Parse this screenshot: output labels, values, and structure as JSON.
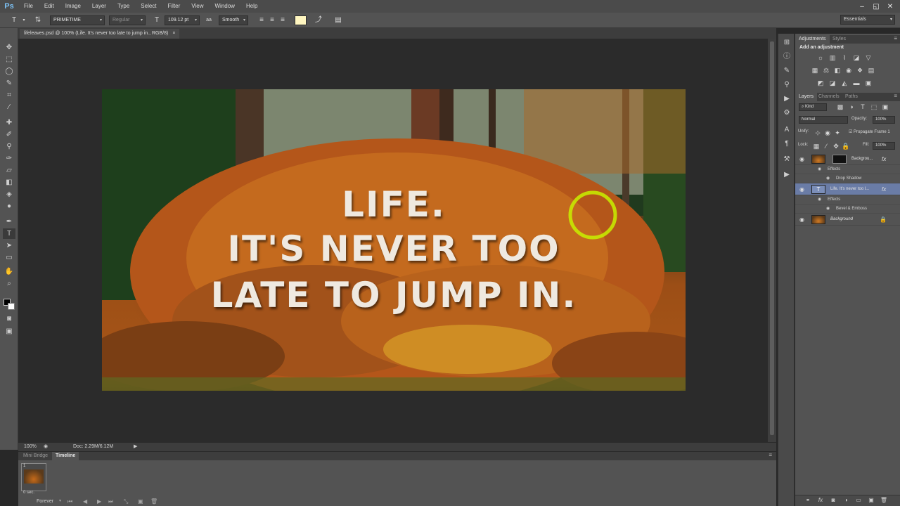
{
  "app": {
    "logo": "Ps",
    "menu": [
      "File",
      "Edit",
      "Image",
      "Layer",
      "Type",
      "Select",
      "Filter",
      "View",
      "Window",
      "Help"
    ],
    "window_controls": [
      "–",
      "◱",
      "✕"
    ]
  },
  "options_bar": {
    "font_family": "PRIMETIME",
    "font_style": "Regular",
    "font_size": "109.12 pt",
    "antialias": "Smooth",
    "text_color": "#fff6c0",
    "workspace": "Essentials"
  },
  "document": {
    "tab_title": "lifeleaves.psd @ 100% (Life. It's never too late to jump in., RGB/8)",
    "close_glyph": "×",
    "canvas_text": [
      "LIFE.",
      "IT'S NEVER TOO",
      "LATE TO JUMP IN."
    ]
  },
  "status_bar": {
    "zoom": "100%",
    "doc_size": "Doc: 2.29M/6.12M"
  },
  "timeline": {
    "tabs": [
      "Mini Bridge",
      "Timeline"
    ],
    "frame_number": "1",
    "frame_delay": "0 sec.",
    "loop": "Forever"
  },
  "adjustments": {
    "tabs": [
      "Adjustments",
      "Styles"
    ],
    "heading": "Add an adjustment"
  },
  "layers": {
    "tabs": [
      "Layers",
      "Channels",
      "Paths"
    ],
    "kind_filter": "Kind",
    "blend_mode": "Normal",
    "opacity_label": "Opacity:",
    "opacity_value": "100%",
    "unify_label": "Unify:",
    "propagate_label": "Propagate Frame 1",
    "lock_label": "Lock:",
    "fill_label": "Fill:",
    "fill_value": "100%",
    "items": [
      {
        "name": "Backgrou...",
        "fx": "fx",
        "effects_label": "Effects",
        "effect": "Drop Shadow"
      },
      {
        "name": "Life. It's never too l...",
        "fx": "fx",
        "effects_label": "Effects",
        "effect": "Bevel & Emboss"
      },
      {
        "name": "Background"
      }
    ]
  }
}
